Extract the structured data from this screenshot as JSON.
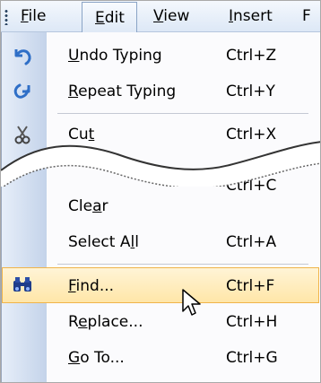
{
  "menubar": {
    "items": [
      {
        "label": "File",
        "mnemonic": "F",
        "rest": "ile"
      },
      {
        "label": "Edit",
        "mnemonic": "E",
        "rest": "dit"
      },
      {
        "label": "View",
        "mnemonic": "V",
        "rest": "iew"
      },
      {
        "label": "Insert",
        "mnemonic": "I",
        "rest": "nsert"
      },
      {
        "label": "F",
        "mnemonic": "",
        "rest": "F"
      }
    ]
  },
  "edit_menu": {
    "items": [
      {
        "pre": "",
        "mn": "U",
        "post": "ndo Typing",
        "shortcut": "Ctrl+Z",
        "icon": "undo-icon"
      },
      {
        "pre": "",
        "mn": "R",
        "post": "epeat Typing",
        "shortcut": "Ctrl+Y",
        "icon": "repeat-icon"
      },
      {
        "pre": "Cu",
        "mn": "t",
        "post": "",
        "shortcut": "Ctrl+X",
        "icon": "scissors-icon"
      },
      {
        "pre": "",
        "mn": "",
        "post": "",
        "shortcut": "Ctrl+C",
        "icon": ""
      },
      {
        "pre": "Cle",
        "mn": "a",
        "post": "r",
        "shortcut": "",
        "icon": ""
      },
      {
        "pre": "Select A",
        "mn": "l",
        "post": "l",
        "shortcut": "Ctrl+A",
        "icon": ""
      },
      {
        "pre": "",
        "mn": "F",
        "post": "ind...",
        "shortcut": "Ctrl+F",
        "icon": "binoculars-icon"
      },
      {
        "pre": "R",
        "mn": "e",
        "post": "place...",
        "shortcut": "Ctrl+H",
        "icon": ""
      },
      {
        "pre": "",
        "mn": "G",
        "post": "o To...",
        "shortcut": "Ctrl+G",
        "icon": ""
      }
    ]
  },
  "colors": {
    "highlight_border": "#f0b44b",
    "highlight_fill": "#ffe9b0",
    "gutter": "#d3dff0",
    "undo_icon": "#2f6fc7"
  }
}
